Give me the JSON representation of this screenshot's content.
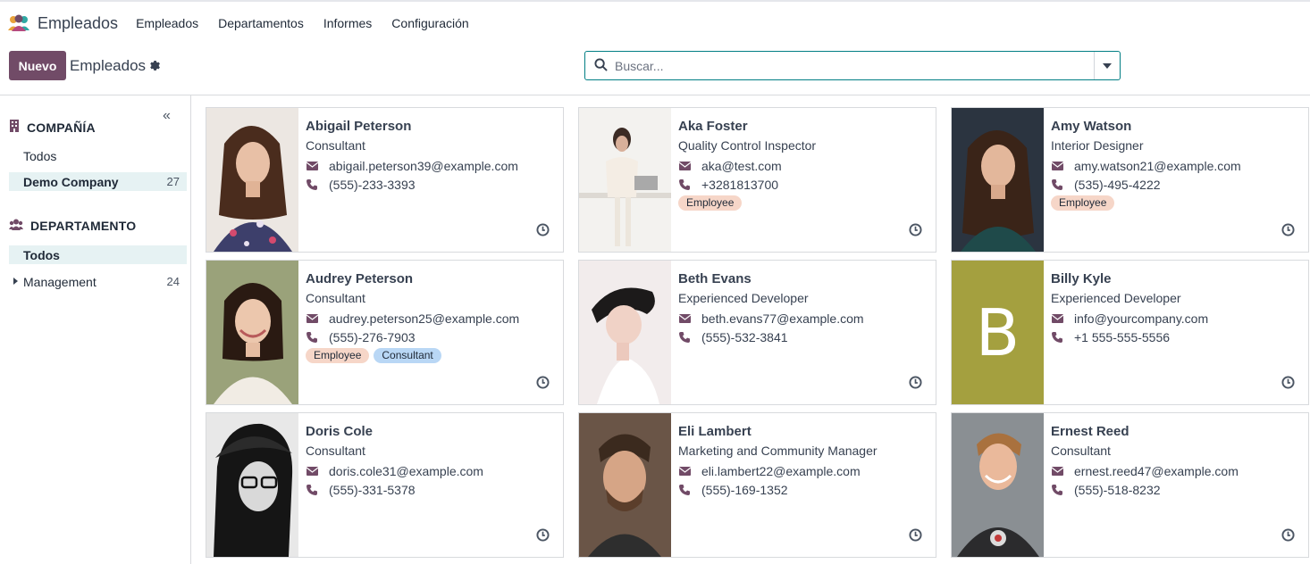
{
  "nav": {
    "app_title": "Empleados",
    "menu": [
      "Empleados",
      "Departamentos",
      "Informes",
      "Configuración"
    ]
  },
  "control": {
    "new_label": "Nuevo",
    "title": "Empleados",
    "search_placeholder": "Buscar..."
  },
  "sidebar": {
    "company_title": "COMPAÑÍA",
    "company_items": [
      {
        "label": "Todos",
        "count": ""
      },
      {
        "label": "Demo Company",
        "count": "27"
      }
    ],
    "department_title": "DEPARTAMENTO",
    "department_items": [
      {
        "label": "Todos",
        "count": ""
      },
      {
        "label": "Management",
        "count": "24"
      }
    ]
  },
  "tag_labels": {
    "employee": "Employee",
    "consultant": "Consultant"
  },
  "employees": [
    {
      "name": "Abigail Peterson",
      "job": "Consultant",
      "email": "abigail.peterson39@example.com",
      "phone": "(555)-233-3393",
      "tags": []
    },
    {
      "name": "Aka Foster",
      "job": "Quality Control Inspector",
      "email": "aka@test.com",
      "phone": "+3281813700",
      "tags": [
        "Employee"
      ]
    },
    {
      "name": "Amy Watson",
      "job": "Interior Designer",
      "email": "amy.watson21@example.com",
      "phone": "(535)-495-4222",
      "tags": [
        "Employee"
      ]
    },
    {
      "name": "Audrey Peterson",
      "job": "Consultant",
      "email": "audrey.peterson25@example.com",
      "phone": "(555)-276-7903",
      "tags": [
        "Employee",
        "Consultant"
      ]
    },
    {
      "name": "Beth Evans",
      "job": "Experienced Developer",
      "email": "beth.evans77@example.com",
      "phone": "(555)-532-3841",
      "tags": []
    },
    {
      "name": "Billy Kyle",
      "job": "Experienced Developer",
      "email": "info@yourcompany.com",
      "phone": "+1 555-555-5556",
      "tags": [],
      "initial": "B"
    },
    {
      "name": "Doris Cole",
      "job": "Consultant",
      "email": "doris.cole31@example.com",
      "phone": "(555)-331-5378",
      "tags": []
    },
    {
      "name": "Eli Lambert",
      "job": "Marketing and Community Manager",
      "email": "eli.lambert22@example.com",
      "phone": "(555)-169-1352",
      "tags": []
    },
    {
      "name": "Ernest Reed",
      "job": "Consultant",
      "email": "ernest.reed47@example.com",
      "phone": "(555)-518-8232",
      "tags": []
    }
  ],
  "colors": {
    "brand": "#714B67",
    "accent": "#017e84",
    "billy_avatar": "#a4a03f"
  }
}
